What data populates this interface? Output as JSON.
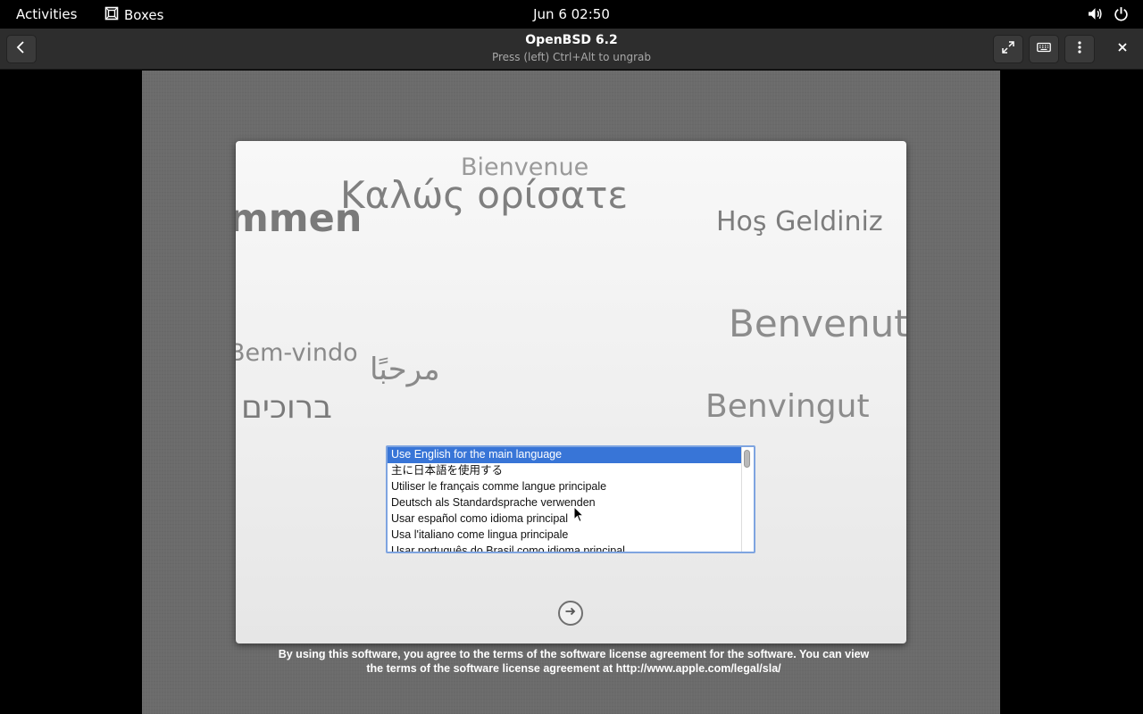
{
  "topbar": {
    "activities": "Activities",
    "app_name": "Boxes",
    "clock": "Jun 6  02:50",
    "icons": [
      "volume-icon",
      "power-icon"
    ]
  },
  "headerbar": {
    "title": "OpenBSD 6.2",
    "subtitle": "Press (left) Ctrl+Alt to ungrab",
    "icons": [
      "back-icon",
      "fullscreen-icon",
      "keyboard-icon",
      "menu-icon",
      "close-icon"
    ]
  },
  "welcome_words": [
    "Bienvenue",
    "Καλώς ορίσατε",
    "mmen",
    "Hoş Geldiniz",
    "Benvenut",
    "Bem-vindo",
    "مرحبًا",
    "ברוכים",
    "Benvingut"
  ],
  "language_list": {
    "items": [
      "Use English for the main language",
      "主に日本語を使用する",
      "Utiliser le français comme langue principale",
      "Deutsch als Standardsprache verwenden",
      "Usar español como idioma principal",
      "Usa l'italiano come lingua principale",
      "Usar português do Brasil como idioma principal"
    ],
    "selected": "Use English for the main language"
  },
  "next_button": "arrow-right-icon",
  "license": {
    "line1": "By using this software, you agree to the terms of the software license agreement for the software. You can view",
    "line2": "the terms of the software license agreement at http://www.apple.com/legal/sla/"
  },
  "colors": {
    "selection": "#3875d7",
    "topbar": "#000000",
    "headerbar": "#2d2d2d"
  }
}
